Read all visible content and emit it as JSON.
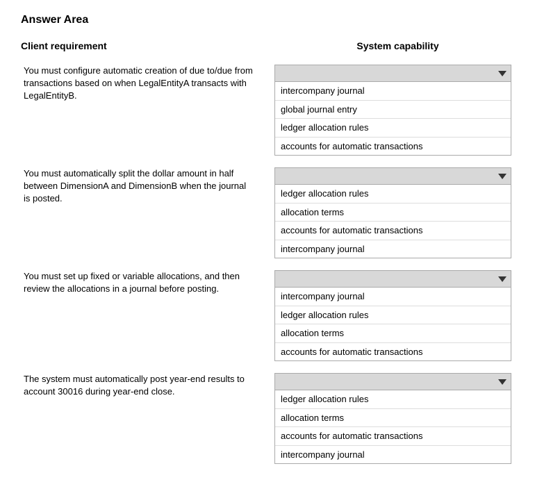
{
  "page": {
    "title": "Answer Area",
    "columns": {
      "left": "Client requirement",
      "right": "System capability"
    }
  },
  "rows": [
    {
      "id": "row1",
      "requirement": "You must configure automatic creation of due to/due from transactions based on when LegalEntityA transacts with LegalEntityB.",
      "dropdown_options": [
        "intercompany journal",
        "global journal entry",
        "ledger allocation rules",
        "accounts for automatic transactions"
      ]
    },
    {
      "id": "row2",
      "requirement": "You must automatically split the dollar amount in half between DimensionA and DimensionB when the journal is posted.",
      "dropdown_options": [
        "ledger allocation rules",
        "allocation terms",
        "accounts for automatic transactions",
        "intercompany journal"
      ]
    },
    {
      "id": "row3",
      "requirement": "You must set up fixed or variable allocations, and then review the allocations in a journal before posting.",
      "dropdown_options": [
        "intercompany journal",
        "ledger allocation rules",
        "allocation terms",
        "accounts for automatic transactions"
      ]
    },
    {
      "id": "row4",
      "requirement": "The system must automatically post year-end results to account 30016 during year-end close.",
      "dropdown_options": [
        "ledger allocation rules",
        "allocation terms",
        "accounts for automatic transactions",
        "intercompany journal"
      ]
    }
  ]
}
